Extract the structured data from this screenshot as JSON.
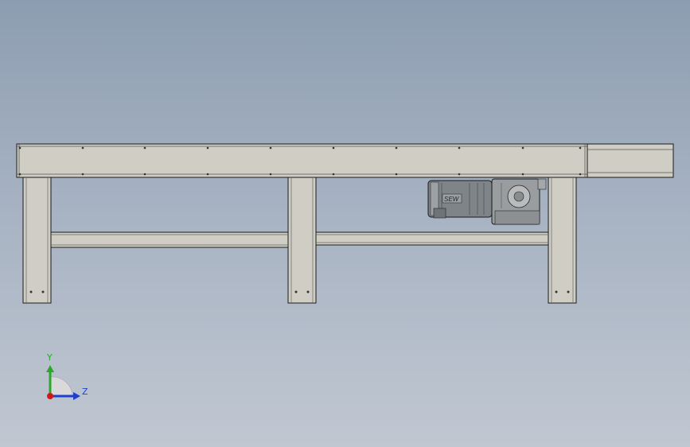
{
  "viewport": {
    "background_top": "#8d9db1",
    "background_bottom": "#c0c7d1"
  },
  "model": {
    "part_fill": "#cfcdc4",
    "part_edge": "#1a1a1a",
    "motor_fill": "#8a8f94",
    "motor_brand": "SEW"
  },
  "triad": {
    "y_label": "Y",
    "z_label": "Z",
    "y_color": "#2aa82a",
    "z_color": "#1f3fd0",
    "x_color": "#d01818"
  }
}
